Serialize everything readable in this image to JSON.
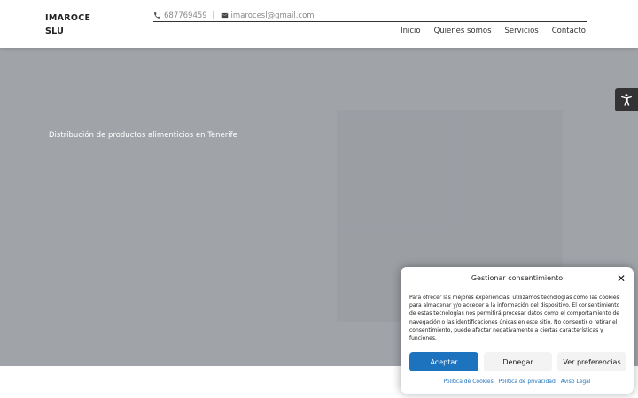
{
  "header": {
    "logo": "IMAROCE SLU",
    "phone": "687769459",
    "separator": "|",
    "email": "imarocesl@gmail.com",
    "nav": [
      "Inicio",
      "Quienes somos",
      "Servicios",
      "Contacto"
    ]
  },
  "hero": {
    "subtitle": "Distribución de productos alimenticios en Tenerife",
    "background_color": "#a0a4a9"
  },
  "accessibility": {
    "icon": "accessibility-icon"
  },
  "consent": {
    "title": "Gestionar consentimiento",
    "text": "Para ofrecer las mejores experiencias, utilizamos tecnologías como las cookies para almacenar y/o acceder a la información del dispositivo. El consentimiento de estas tecnologías nos permitirá procesar datos como el comportamiento de navegación o las identificaciones únicas en este sitio. No consentir o retirar el consentimiento, puede afectar negativamente a ciertas características y funciones.",
    "accept": "Aceptar",
    "deny": "Denegar",
    "preferences": "Ver preferencias",
    "links": [
      "Política de Cookies",
      "Política de privacidad",
      "Aviso Legal"
    ],
    "accent_color": "#1e73be"
  }
}
